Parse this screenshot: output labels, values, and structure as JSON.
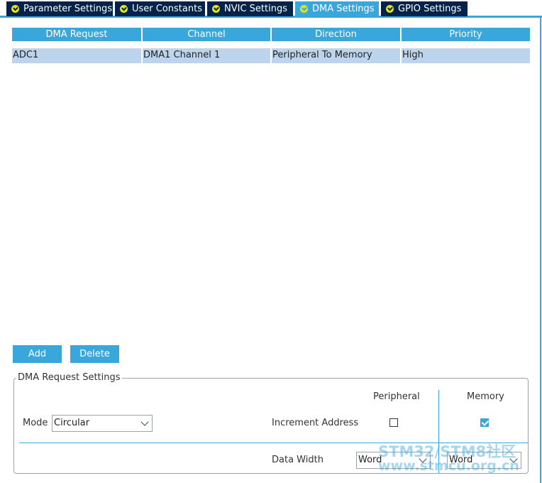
{
  "tabs": [
    {
      "label": "Parameter Settings",
      "active": false
    },
    {
      "label": "User Constants",
      "active": false
    },
    {
      "label": "NVIC Settings",
      "active": false
    },
    {
      "label": "DMA Settings",
      "active": true
    },
    {
      "label": "GPIO Settings",
      "active": false
    }
  ],
  "table": {
    "columns": [
      "DMA Request",
      "Channel",
      "Direction",
      "Priority"
    ],
    "rows": [
      [
        "ADC1",
        "DMA1 Channel 1",
        "Peripheral To Memory",
        "High"
      ]
    ]
  },
  "buttons": {
    "add": "Add",
    "delete": "Delete"
  },
  "settings": {
    "group_title": "DMA Request Settings",
    "peripheral_header": "Peripheral",
    "memory_header": "Memory",
    "mode_label": "Mode",
    "mode_value": "Circular",
    "increment_label": "Increment Address",
    "peripheral_increment": false,
    "memory_increment": true,
    "data_width_label": "Data Width",
    "peripheral_width": "Word",
    "memory_width": "Word"
  },
  "watermark": {
    "line1": "STM32/STM8社区",
    "line2": "www.stmcu.org.cn"
  },
  "colors": {
    "tab_dark": "#03234b",
    "accent": "#3aa7dc",
    "check_yellow": "#e3e31a",
    "row_selected": "#bcd4ec"
  }
}
